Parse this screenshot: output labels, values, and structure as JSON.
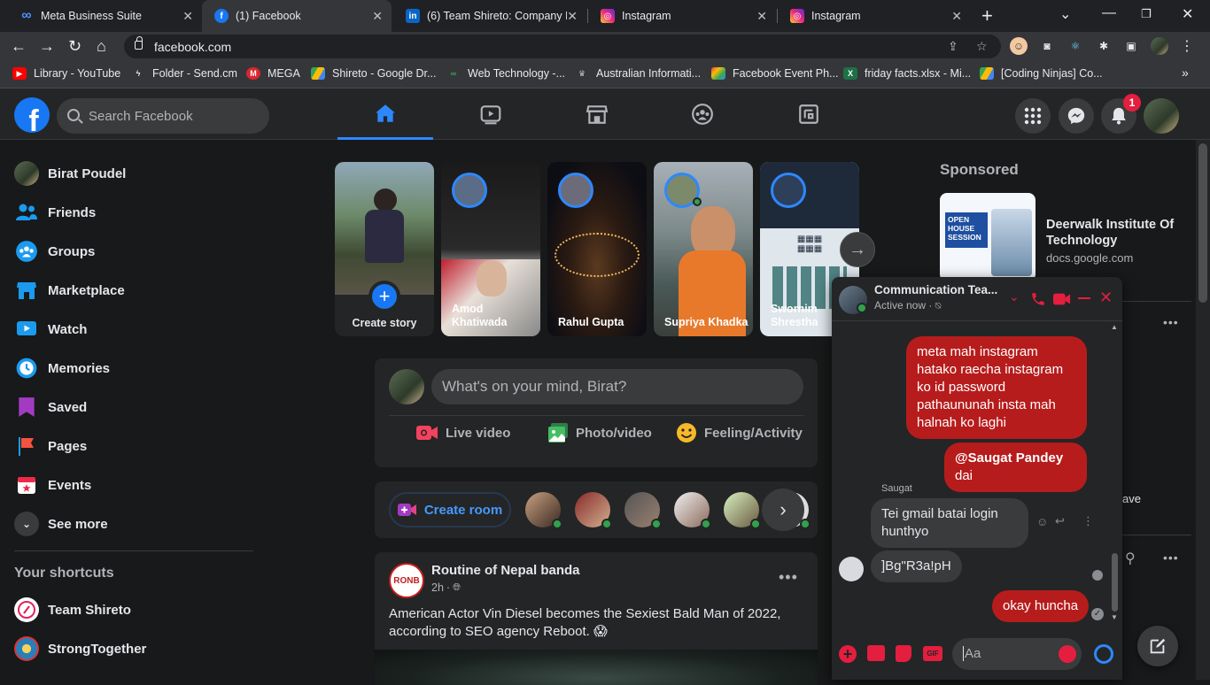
{
  "browser": {
    "tabs": [
      {
        "title": "Meta Business Suite",
        "icon": "meta-icon"
      },
      {
        "title": "(1) Facebook",
        "icon": "facebook-icon"
      },
      {
        "title": "(6) Team Shireto: Company P",
        "icon": "linkedin-icon"
      },
      {
        "title": "Instagram",
        "icon": "instagram-icon"
      },
      {
        "title": "Instagram",
        "icon": "instagram-icon"
      }
    ],
    "url": "facebook.com",
    "bookmarks": [
      {
        "label": "Library - YouTube",
        "color": "#ff0000"
      },
      {
        "label": "Folder - Send.cm",
        "color": "#e8eaed"
      },
      {
        "label": "MEGA",
        "color": "#d9272e"
      },
      {
        "label": "Shireto - Google Dr...",
        "color": "#fbbc04"
      },
      {
        "label": "Web Technology -...",
        "color": "#34a853"
      },
      {
        "label": "Australian Informati...",
        "color": "#9aa0a6"
      },
      {
        "label": "Facebook Event Ph...",
        "color": "#f4b400"
      },
      {
        "label": "friday facts.xlsx - Mi...",
        "color": "#1e7145"
      },
      {
        "label": "[Coding Ninjas] Co...",
        "color": "#fbbc04"
      }
    ]
  },
  "topbar": {
    "search_placeholder": "Search Facebook",
    "notification_count": "1",
    "accent": "#2d88ff"
  },
  "sidebar": {
    "items": [
      {
        "label": "Birat Poudel",
        "icon": "profile-avatar"
      },
      {
        "label": "Friends",
        "icon": "friends-icon"
      },
      {
        "label": "Groups",
        "icon": "groups-icon"
      },
      {
        "label": "Marketplace",
        "icon": "marketplace-icon"
      },
      {
        "label": "Watch",
        "icon": "watch-icon"
      },
      {
        "label": "Memories",
        "icon": "memories-icon"
      },
      {
        "label": "Saved",
        "icon": "saved-icon"
      },
      {
        "label": "Pages",
        "icon": "pages-icon"
      },
      {
        "label": "Events",
        "icon": "events-icon"
      },
      {
        "label": "See more",
        "icon": "chevron-down-icon"
      }
    ],
    "shortcuts_title": "Your shortcuts",
    "shortcuts": [
      {
        "label": "Team Shireto"
      },
      {
        "label": "StrongTogether"
      }
    ]
  },
  "stories": [
    {
      "name": "Create story"
    },
    {
      "name": "Amod Khatiwada"
    },
    {
      "name": "Rahul Gupta"
    },
    {
      "name": "Supriya Khadka"
    },
    {
      "name": "Swornim Shrestha"
    }
  ],
  "composer": {
    "placeholder": "What's on your mind, Birat?",
    "actions": [
      "Live video",
      "Photo/video",
      "Feeling/Activity"
    ]
  },
  "rooms": {
    "create_label": "Create room"
  },
  "post": {
    "author": "Routine of Nepal banda",
    "time": "2h",
    "text": "American Actor Vin Diesel becomes the Sexiest Bald Man of 2022, according to SEO agency Reboot. 😱",
    "logo_text": "RONB"
  },
  "sponsored": {
    "title": "Sponsored",
    "ad_title": "Deerwalk Institute Of Technology",
    "ad_url": "docs.google.com",
    "ad_image_text": "OPEN HOUSE SESSION"
  },
  "right_partial": {
    "ave_text": "ave"
  },
  "chat": {
    "name": "Communication Tea...",
    "status": "Active now ·",
    "messages": [
      {
        "from": "me",
        "text": "meta mah instagram hatako raecha instagram ko id password pathaununah insta mah halnah ko laghi"
      },
      {
        "from": "me",
        "mention": "@Saugat Pandey",
        "text": " dai"
      },
      {
        "from": "them",
        "sender": "Saugat",
        "text": "Tei gmail batai login hunthyo"
      },
      {
        "from": "them",
        "text": "]Bg\"R3a!pH"
      },
      {
        "from": "me",
        "text": "okay huncha"
      }
    ],
    "input_placeholder": "Aa",
    "accent": "#e41e3f"
  }
}
